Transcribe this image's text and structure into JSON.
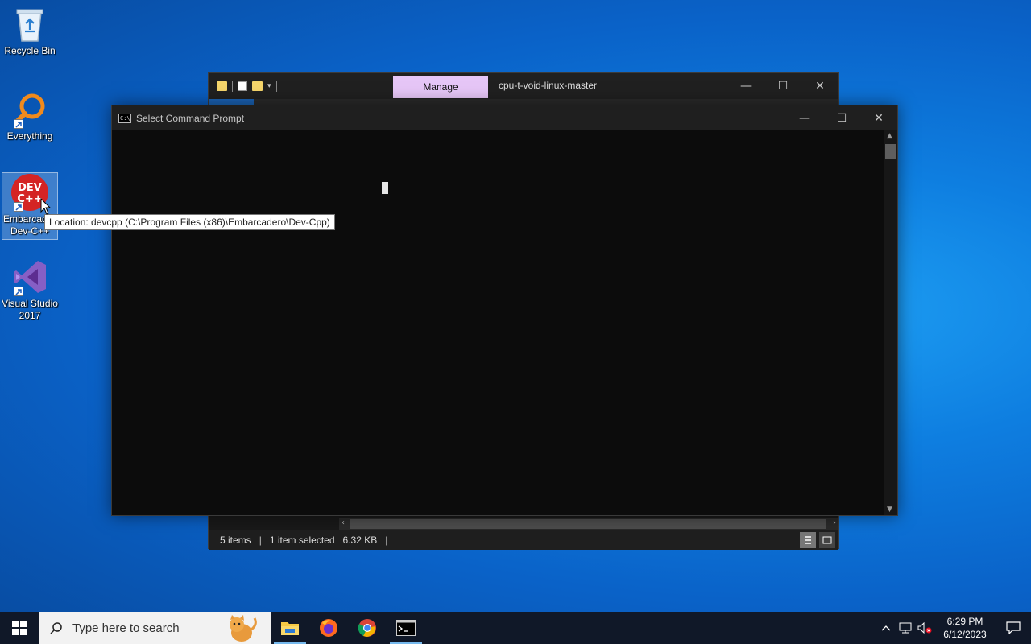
{
  "desktop": {
    "icons": [
      {
        "label": "Recycle Bin"
      },
      {
        "label": "Everything"
      },
      {
        "label": "Embarcadero Dev-C++",
        "badge": "DEV C++"
      },
      {
        "label": "Visual Studio 2017"
      }
    ],
    "tooltip": "Location: devcpp (C:\\Program Files (x86)\\Embarcadero\\Dev-Cpp)"
  },
  "explorer": {
    "manage_tab": "Manage",
    "title": "cpu-t-void-linux-master",
    "status": {
      "items": "5 items",
      "selected": "1 item selected",
      "size": "6.32 KB"
    }
  },
  "cmd": {
    "title": "Select Command Prompt",
    "icon_text": "C:\\"
  },
  "window_controls": {
    "minimize": "—",
    "maximize": "☐",
    "close": "✕"
  },
  "taskbar": {
    "search_placeholder": "Type here to search",
    "apps": [
      "file-explorer",
      "firefox",
      "chrome",
      "command-prompt"
    ],
    "clock": {
      "time": "6:29 PM",
      "date": "6/12/2023"
    }
  },
  "colors": {
    "manage_tab": "#e6c6f7",
    "taskbar": "#101828",
    "cmd_bg": "#0c0c0c"
  }
}
